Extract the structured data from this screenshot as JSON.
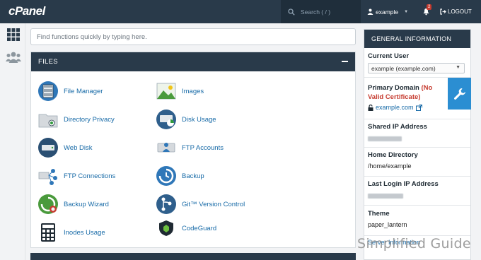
{
  "topbar": {
    "logo": "cPanel",
    "search_placeholder": "Search ( / )",
    "user": "example",
    "notification_count": "2",
    "logout": "LOGOUT"
  },
  "main": {
    "search_placeholder": "Find functions quickly by typing here.",
    "files": {
      "title": "FILES",
      "items": [
        {
          "label": "File Manager",
          "icon": "file-manager-icon"
        },
        {
          "label": "Images",
          "icon": "images-icon"
        },
        {
          "label": "Directory Privacy",
          "icon": "directory-privacy-icon"
        },
        {
          "label": "Disk Usage",
          "icon": "disk-usage-icon"
        },
        {
          "label": "Web Disk",
          "icon": "web-disk-icon"
        },
        {
          "label": "FTP Accounts",
          "icon": "ftp-accounts-icon"
        },
        {
          "label": "FTP Connections",
          "icon": "ftp-connections-icon"
        },
        {
          "label": "Backup",
          "icon": "backup-icon"
        },
        {
          "label": "Backup Wizard",
          "icon": "backup-wizard-icon"
        },
        {
          "label": "Git™ Version Control",
          "icon": "git-icon"
        },
        {
          "label": "Inodes Usage",
          "icon": "inodes-usage-icon"
        },
        {
          "label": "CodeGuard",
          "icon": "codeguard-icon"
        }
      ]
    }
  },
  "sidebar": {
    "title": "GENERAL INFORMATION",
    "current_user_label": "Current User",
    "current_user_value": "example (example.com)",
    "primary_domain_label": "Primary Domain",
    "primary_domain_status": "(No Valid Certificate)",
    "primary_domain_value": "example.com",
    "shared_ip_label": "Shared IP Address",
    "home_dir_label": "Home Directory",
    "home_dir_value": "/home/example",
    "last_login_label": "Last Login IP Address",
    "theme_label": "Theme",
    "theme_value": "paper_lantern",
    "server_info_link": "Server Information"
  },
  "watermark": "Simplified Guide",
  "colors": {
    "navy": "#293a4a",
    "link": "#176aa7",
    "accent_blue": "#2b8ed2",
    "warning_red": "#c63b2f"
  }
}
